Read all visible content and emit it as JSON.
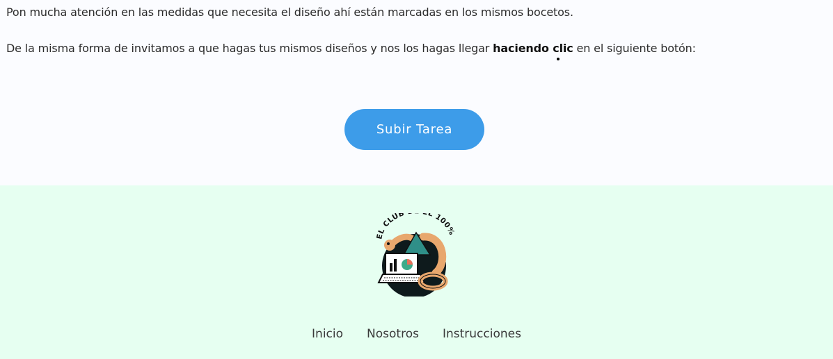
{
  "content": {
    "paragraph_1": "Pon mucha atención en las medidas que necesita el diseño ahí están marcadas en los mismos bocetos.",
    "paragraph_2_before": "De la misma forma de invitamos a que hagas tus mismos diseños y nos los hagas llegar ",
    "paragraph_2_bold": "haciendo clic",
    "paragraph_2_after": " en el siguiente botón:",
    "upload_button_label": "Subir Tarea"
  },
  "footer": {
    "logo_text": "EL CLUB DE EL 100%",
    "nav": [
      {
        "label": "Inicio"
      },
      {
        "label": "Nosotros"
      },
      {
        "label": "Instrucciones"
      }
    ]
  },
  "colors": {
    "button": "#3d9ce9",
    "footer_bg": "#e6fff1",
    "page_bg": "#fbfcff"
  }
}
